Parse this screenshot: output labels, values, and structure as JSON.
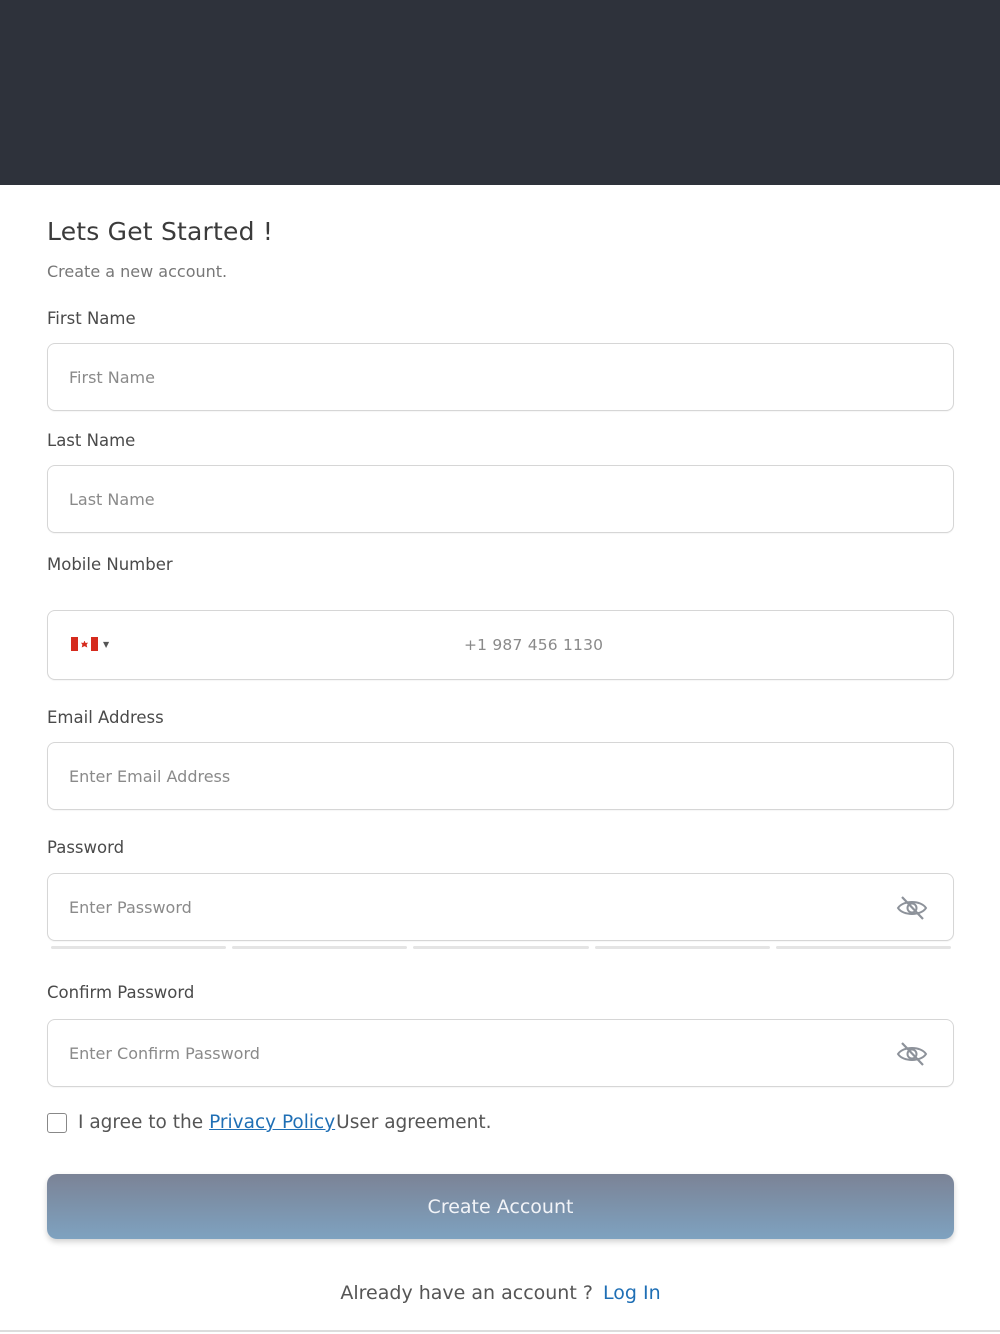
{
  "header": {},
  "form": {
    "title": "Lets Get Started !",
    "subtitle": "Create a new account.",
    "first_name": {
      "label": "First Name",
      "placeholder": "First Name"
    },
    "last_name": {
      "label": "Last Name",
      "placeholder": "Last Name"
    },
    "mobile": {
      "label": "Mobile Number",
      "country_flag": "canada-flag-icon",
      "placeholder": "+1 987 456 1130"
    },
    "email": {
      "label": "Email Address",
      "placeholder": "Enter Email Address"
    },
    "password": {
      "label": "Password",
      "placeholder": "Enter Password",
      "toggle_icon": "eye-off-icon"
    },
    "confirm_password": {
      "label": "Confirm Password",
      "placeholder": "Enter Confirm Password",
      "toggle_icon": "eye-off-icon"
    },
    "agreement": {
      "prefix": "I agree to the",
      "link": "Privacy Policy",
      "suffix": "User agreement."
    },
    "submit_label": "Create Account",
    "login_prompt": "Already have an account ?",
    "login_link": "Log In"
  },
  "colors": {
    "banner": "#2e323b",
    "link": "#1f6fb5",
    "button_gradient_top": "#7b8396",
    "button_gradient_bottom": "#7ea2c0"
  }
}
